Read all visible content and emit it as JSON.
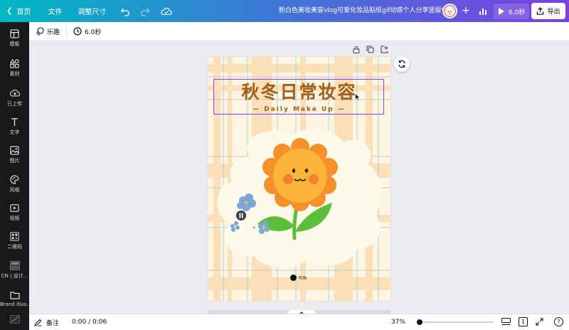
{
  "topbar": {
    "home_label": "首页",
    "file_label": "文件",
    "resize_label": "调整尺寸",
    "doc_title": "粉白色美妆美容vlog可爱化妆品贴纸gif动感个人分享竖版Vlog",
    "play_label": "6.0秒",
    "export_label": "导出"
  },
  "sidebar": {
    "items": [
      {
        "label": "模板",
        "icon": "template-icon"
      },
      {
        "label": "素材",
        "icon": "elements-icon"
      },
      {
        "label": "已上传",
        "icon": "upload-icon"
      },
      {
        "label": "文字",
        "icon": "text-icon"
      },
      {
        "label": "图片",
        "icon": "photo-icon"
      },
      {
        "label": "风格",
        "icon": "style-icon"
      },
      {
        "label": "视频",
        "icon": "video-icon"
      },
      {
        "label": "二维码",
        "icon": "qrcode-icon"
      },
      {
        "label": "CN | 设计...",
        "icon": "brand-folder-icon"
      },
      {
        "label": "Brand Illus...",
        "icon": "folder-icon"
      }
    ]
  },
  "toolbar2": {
    "animation_label": "乐趣",
    "duration_label": "6.0秒"
  },
  "design": {
    "title": "秋冬日常妆容",
    "subtitle": "— Daily Make Up —",
    "watermark": "可画"
  },
  "bottombar": {
    "notes_label": "备注",
    "time_label": "0:00 / 0:06",
    "zoom_label": "37%",
    "page_number": "1",
    "timeline_progress": 0
  },
  "colors": {
    "brand_gradient_start": "#00b8c4",
    "brand_gradient_end": "#7b3fe4",
    "selection": "#8b3dff",
    "title_brown": "#a0601c",
    "petal_orange": "#f5902a",
    "face_yellow": "#fdb43a",
    "leaf_green": "#5cbf3a"
  }
}
